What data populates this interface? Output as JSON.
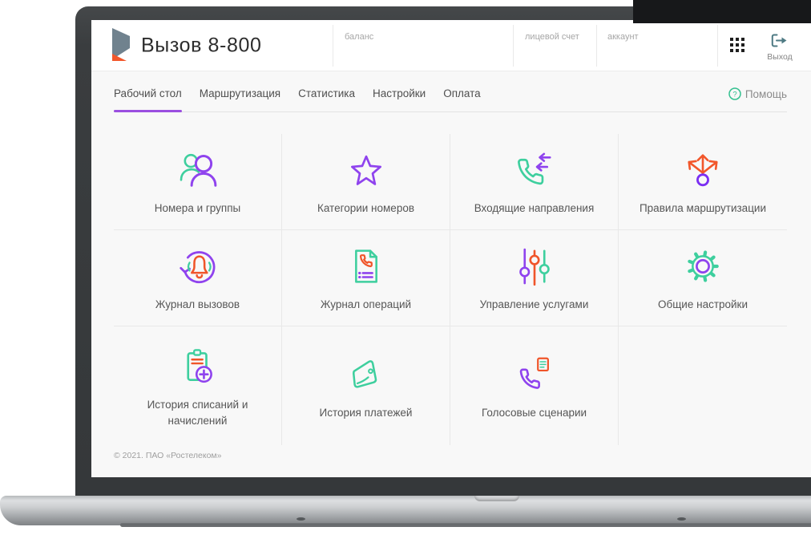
{
  "header": {
    "title": "Вызов 8-800",
    "fields": [
      {
        "label": "баланс"
      },
      {
        "label": "лицевой счет"
      },
      {
        "label": "аккаунт"
      }
    ],
    "logout_label": "Выход"
  },
  "nav": {
    "tabs": [
      {
        "label": "Рабочий стол",
        "active": true
      },
      {
        "label": "Маршрутизация",
        "active": false
      },
      {
        "label": "Статистика",
        "active": false
      },
      {
        "label": "Настройки",
        "active": false
      },
      {
        "label": "Оплата",
        "active": false
      }
    ],
    "help_label": "Помощь",
    "help_glyph": "?"
  },
  "tiles": [
    {
      "label": "Номера и группы",
      "icon": "users-icon"
    },
    {
      "label": "Категории номеров",
      "icon": "star-icon"
    },
    {
      "label": "Входящие направления",
      "icon": "incoming-call-icon"
    },
    {
      "label": "Правила маршрутизации",
      "icon": "routing-arrows-icon"
    },
    {
      "label": "Журнал вызовов",
      "icon": "call-log-bell-icon"
    },
    {
      "label": "Журнал операций",
      "icon": "operations-document-icon"
    },
    {
      "label": "Управление услугами",
      "icon": "sliders-icon"
    },
    {
      "label": "Общие настройки",
      "icon": "gear-icon"
    },
    {
      "label": "История списаний и начислений",
      "icon": "clipboard-plus-icon"
    },
    {
      "label": "История платежей",
      "icon": "wallet-icon"
    },
    {
      "label": "Голосовые сценарии",
      "icon": "voice-script-phone-icon"
    }
  ],
  "footer": {
    "copyright": "© 2021. ПАО «Ростелеком»"
  },
  "theme": {
    "purple": "#8f43ee",
    "green": "#3ecf9e",
    "orange": "#f2572b",
    "accent_underline": "#9b4fe0",
    "help_green": "#33c08f",
    "text_dark": "#2d2d2d",
    "text_gray": "#a6a6a6",
    "bezel": "#3a3d3f"
  }
}
